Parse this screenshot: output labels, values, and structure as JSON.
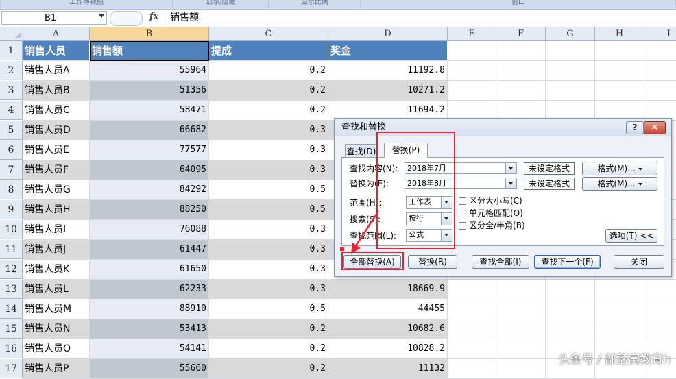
{
  "ribbon": {
    "groups": [
      "工作簿视图",
      "显示/隐藏",
      "显示比例",
      "窗口"
    ]
  },
  "formula_bar": {
    "name_box": "B1",
    "fx": "fx",
    "formula": "销售额"
  },
  "columns": [
    "A",
    "B",
    "C",
    "D",
    "E",
    "F",
    "G",
    "H",
    "I"
  ],
  "table": {
    "headers": [
      "销售人员",
      "销售额",
      "提成",
      "奖金"
    ],
    "rows": [
      [
        "销售人员A",
        "55964",
        "0.2",
        "11192.8"
      ],
      [
        "销售人员B",
        "51356",
        "0.2",
        "10271.2"
      ],
      [
        "销售人员C",
        "58471",
        "0.2",
        "11694.2"
      ],
      [
        "销售人员D",
        "66682",
        "0.3",
        ""
      ],
      [
        "销售人员E",
        "77577",
        "0.3",
        ""
      ],
      [
        "销售人员F",
        "64095",
        "0.3",
        ""
      ],
      [
        "销售人员G",
        "84292",
        "0.5",
        ""
      ],
      [
        "销售人员H",
        "88250",
        "0.5",
        ""
      ],
      [
        "销售人员I",
        "76088",
        "0.3",
        ""
      ],
      [
        "销售人员J",
        "61447",
        "0.3",
        ""
      ],
      [
        "销售人员K",
        "61650",
        "0.3",
        ""
      ],
      [
        "销售人员L",
        "62233",
        "0.3",
        "18669.9"
      ],
      [
        "销售人员M",
        "88910",
        "0.5",
        "44455"
      ],
      [
        "销售人员N",
        "53413",
        "0.2",
        "10682.6"
      ],
      [
        "销售人员O",
        "54141",
        "0.2",
        "10828.2"
      ],
      [
        "销售人员P",
        "55660",
        "0.2",
        "11132"
      ]
    ]
  },
  "dialog": {
    "title": "查找和替换",
    "help": "?",
    "close": "✕",
    "tabs": [
      "查找(D)",
      "替换(P)"
    ],
    "find_label": "查找内容(N):",
    "find_value": "2018年7月",
    "replace_label": "替换为(E):",
    "replace_value": "2018年8月",
    "no_format": "未设定格式",
    "format_btn": "格式(M)...",
    "scope_label": "范围(H):",
    "scope_value": "工作表",
    "search_label": "搜索(S):",
    "search_value": "按行",
    "lookin_label": "查找范围(L):",
    "lookin_value": "公式",
    "match_case": "区分大小写(C)",
    "match_cell": "单元格匹配(O)",
    "match_width": "区分全/半角(B)",
    "options_btn": "选项(T) <<",
    "replace_all": "全部替换(A)",
    "replace": "替换(R)",
    "find_all": "查找全部(I)",
    "find_next": "查找下一个(F)",
    "close_btn": "关闭"
  },
  "watermark": "头条号 / 部落窝教育h"
}
